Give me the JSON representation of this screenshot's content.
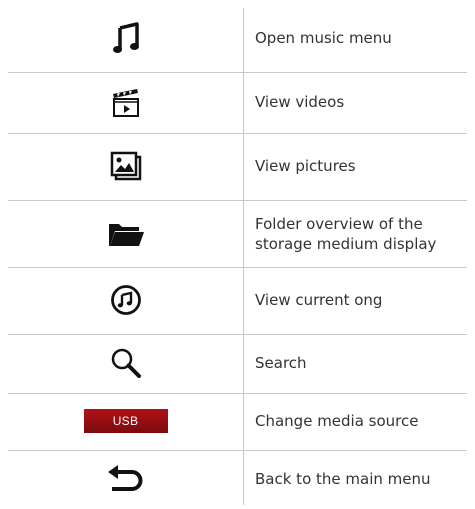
{
  "rows": [
    {
      "icon": "music-note-icon",
      "label": "Open music menu"
    },
    {
      "icon": "video-clapperboard-icon",
      "label": "View videos"
    },
    {
      "icon": "pictures-icon",
      "label": "View pictures"
    },
    {
      "icon": "folder-icon",
      "label": "Folder overview of the storage medium display"
    },
    {
      "icon": "current-song-icon",
      "label": "View current ong"
    },
    {
      "icon": "search-icon",
      "label": "Search"
    },
    {
      "icon": "usb-source-icon",
      "label": "Change media source",
      "badge": "USB"
    },
    {
      "icon": "back-arrow-icon",
      "label": "Back to the main menu"
    }
  ],
  "colors": {
    "badge_red": "#9a0f14",
    "separator": "#c9c9c9",
    "text": "#333333"
  }
}
